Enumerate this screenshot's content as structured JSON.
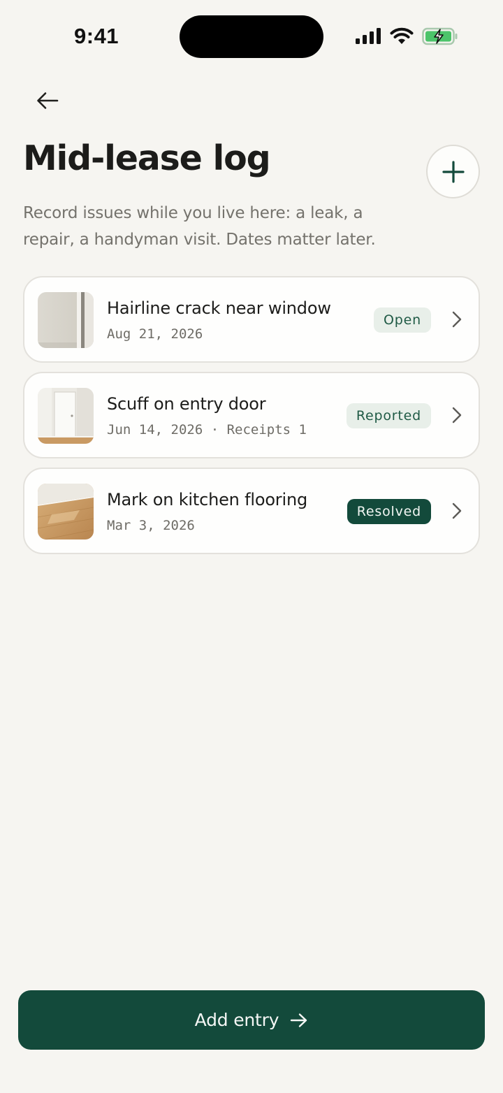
{
  "status_bar": {
    "time": "9:41",
    "icons": [
      "signal-icon",
      "wifi-icon",
      "battery-charging-icon"
    ],
    "battery_color": "#4cc46a"
  },
  "header": {
    "back_icon": "arrow-left-icon",
    "title": "Mid-lease log",
    "add_icon": "plus-icon",
    "subtitle": "Record issues while you live here: a leak, a repair, a handyman visit. Dates matter later."
  },
  "entries": [
    {
      "title": "Hairline crack near window",
      "meta": "Aug 21, 2026",
      "status": "Open",
      "thumbnail": "wall-corner-photo"
    },
    {
      "title": "Scuff on entry door",
      "meta": "Jun 14, 2026 · Receipts 1",
      "status": "Reported",
      "thumbnail": "white-door-photo"
    },
    {
      "title": "Mark on kitchen flooring",
      "meta": "Mar 3, 2026",
      "status": "Resolved",
      "thumbnail": "wood-floor-photo"
    }
  ],
  "cta": {
    "label": "Add entry",
    "icon": "arrow-right-icon"
  },
  "colors": {
    "background": "#f6f5f1",
    "accent": "#134a3b",
    "badge_light_bg": "#e8efe9",
    "badge_light_text": "#1f5a45",
    "text_primary": "#1c1c1a",
    "text_secondary": "#74726c"
  }
}
